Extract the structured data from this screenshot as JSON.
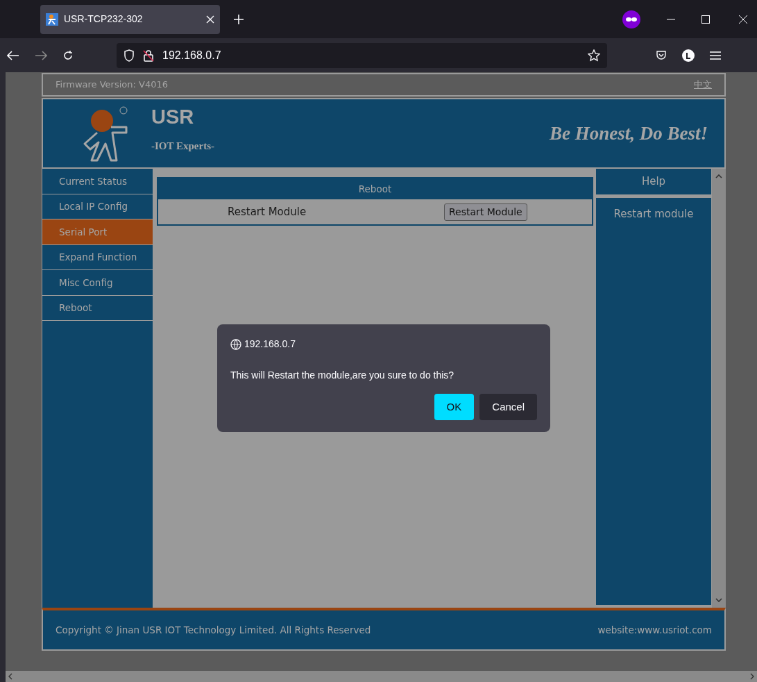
{
  "browser": {
    "tab_title": "USR-TCP232-302",
    "address": "192.168.0.7"
  },
  "page": {
    "firmware_version": "Firmware Version:  V4016",
    "language_link": "中文",
    "logo_text": "USR",
    "tagline": "-IOT Experts-",
    "slogan": "Be Honest, Do Best!",
    "menu": [
      {
        "label": "Current Status",
        "selected": false
      },
      {
        "label": "Local IP Config",
        "selected": false
      },
      {
        "label": "Serial Port",
        "selected": true
      },
      {
        "label": "Expand Function",
        "selected": false
      },
      {
        "label": "Misc Config",
        "selected": false
      },
      {
        "label": "Reboot",
        "selected": false
      }
    ],
    "panel": {
      "title": "Reboot",
      "rows": [
        {
          "label": "Restart Module",
          "button": "Restart Module"
        }
      ]
    },
    "help": {
      "title": "Help",
      "text": "Restart module"
    },
    "footer": {
      "copyright": "Copyright © Jinan USR IOT Technology Limited. All Rights Reserved",
      "website_label": "website:",
      "website_link": "www.usriot.com"
    }
  },
  "dialog": {
    "origin": "192.168.0.7",
    "message": "This will Restart the module,are you sure to do this?",
    "buttons": [
      {
        "label": "OK",
        "kind": "primary"
      },
      {
        "label": "Cancel",
        "kind": "secondary"
      }
    ]
  }
}
